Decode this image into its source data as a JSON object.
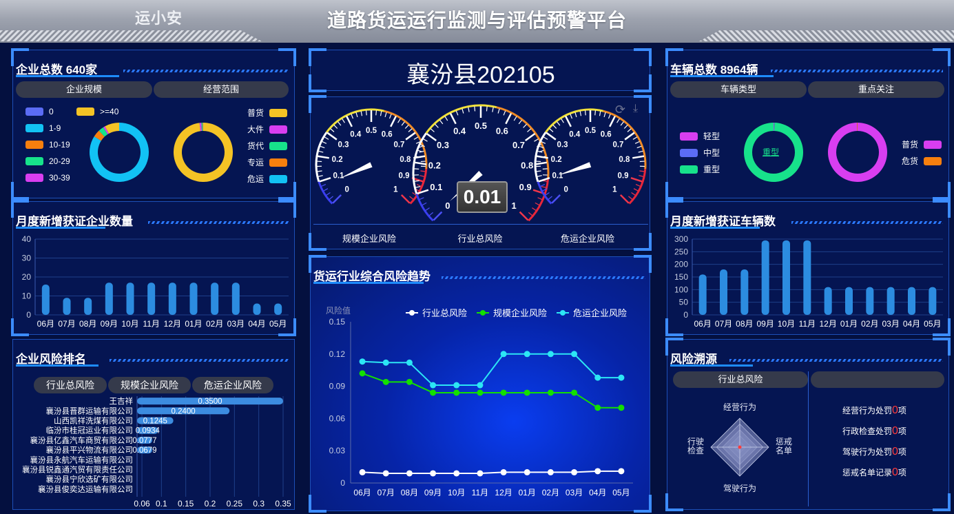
{
  "header": {
    "logo": "运小安",
    "title": "道路货运运行监测与评估预警平台"
  },
  "company": {
    "title": "企业总数 640家",
    "tabs": [
      "企业规模",
      "经营范围"
    ],
    "scale_legend": [
      {
        "label": "0",
        "color": "#5b6cf5"
      },
      {
        "label": ">=40",
        "color": "#f4c325"
      },
      {
        "label": "1-9",
        "color": "#12c2f4"
      },
      {
        "label": "10-19",
        "color": "#f77f0e"
      },
      {
        "label": "20-29",
        "color": "#17e28b"
      },
      {
        "label": "30-39",
        "color": "#d83ef0"
      }
    ],
    "scope_legend": [
      {
        "label": "普货",
        "color": "#f4c325"
      },
      {
        "label": "大件",
        "color": "#d83ef0"
      },
      {
        "label": "货代",
        "color": "#17e28b"
      },
      {
        "label": "专运",
        "color": "#f77f0e"
      },
      {
        "label": "危运",
        "color": "#12c2f4"
      }
    ]
  },
  "monthly_companies": {
    "title": "月度新增获证企业数量"
  },
  "risk_rank": {
    "title": "企业风险排名",
    "buttons": [
      "行业总风险",
      "规模企业风险",
      "危运企业风险"
    ]
  },
  "center": {
    "county_title": "襄汾县202105",
    "gauge_value": "0.01",
    "gauge_labels": [
      "规模企业风险",
      "行业总风险",
      "危运企业风险"
    ],
    "gauge_ticks": [
      "0",
      "0.1",
      "0.2",
      "0.3",
      "0.4",
      "0.5",
      "0.6",
      "0.7",
      "0.8",
      "0.9",
      "1"
    ],
    "trend_title": "货运行业综合风险趋势",
    "trend_yname": "风险值"
  },
  "vehicle": {
    "title": "车辆总数 8964辆",
    "tabs": [
      "车辆类型",
      "重点关注"
    ],
    "type_legend": [
      {
        "label": "轻型",
        "color": "#d83ef0"
      },
      {
        "label": "中型",
        "color": "#5b6cf5"
      },
      {
        "label": "重型",
        "color": "#17e28b"
      }
    ],
    "donut_center_label": "重型",
    "focus_legend": [
      {
        "label": "普货",
        "color": "#d83ef0"
      },
      {
        "label": "危货",
        "color": "#f77f0e"
      }
    ]
  },
  "monthly_vehicles": {
    "title": "月度新增获证车辆数"
  },
  "risk_source": {
    "title": "风险溯源",
    "tab": "行业总风险",
    "radar_labels": {
      "top": "经营行为",
      "right": "惩戒\n名单",
      "bottom": "驾驶行为",
      "left": "行驶\n检查"
    },
    "items": [
      {
        "label": "经营行为处罚",
        "count": "0",
        "unit": "项"
      },
      {
        "label": "行政检查处罚",
        "count": "0",
        "unit": "项"
      },
      {
        "label": "驾驶行为处罚",
        "count": "0",
        "unit": "项"
      },
      {
        "label": "惩戒名单记录",
        "count": "0",
        "unit": "项"
      }
    ]
  },
  "colors": {
    "bar": "#2c8ce0",
    "accent": "#1e8cff",
    "white_line": "#ffffff",
    "green_line": "#13e000",
    "cyan_line": "#2ce6f5"
  },
  "chart_data": [
    {
      "id": "company_scale_donut",
      "type": "pie",
      "categories": [
        "0",
        "1-9",
        "10-19",
        "20-29",
        "30-39",
        ">=40"
      ],
      "values": [
        0,
        84,
        4,
        3,
        1,
        8
      ]
    },
    {
      "id": "company_scope_donut",
      "type": "pie",
      "categories": [
        "普货",
        "大件",
        "货代",
        "专运",
        "危运"
      ],
      "values": [
        98,
        1,
        0.5,
        0.3,
        0.2
      ]
    },
    {
      "id": "monthly_companies",
      "type": "bar",
      "categories": [
        "06月",
        "07月",
        "08月",
        "09月",
        "10月",
        "11月",
        "12月",
        "01月",
        "02月",
        "03月",
        "04月",
        "05月"
      ],
      "values": [
        16,
        9,
        9,
        17,
        17,
        17,
        17,
        17,
        17,
        17,
        6,
        6
      ],
      "ylim": [
        0,
        40
      ],
      "yticks": [
        0,
        10,
        20,
        30,
        40
      ]
    },
    {
      "id": "risk_rank",
      "type": "bar",
      "orientation": "horizontal",
      "categories": [
        "王吉祥",
        "襄汾县晋群运输有限公司",
        "山西凯祥洗煤有限公司",
        "临汾市桂冠运业有限公司",
        "襄汾县亿鑫汽车商贸有限公司",
        "襄汾县平兴物流有限公司",
        "襄汾县永航汽车运输有限公司",
        "襄汾县锐鑫通汽贸有限责任公司",
        "襄汾县宁欣选矿有限公司",
        "襄汾县俊奕达运输有限公司"
      ],
      "values": [
        0.35,
        0.24,
        0.1245,
        0.0934,
        0.0777,
        0.0679,
        null,
        null,
        null,
        null
      ],
      "value_labels": [
        "0.3500",
        "0.2400",
        "0.1245",
        "0.0934",
        "0.0777",
        "0.0679"
      ],
      "xlim": [
        0.05,
        0.35
      ],
      "xticks": [
        "0.06",
        "0.1",
        "0.15",
        "0.2",
        "0.25",
        "0.3",
        "0.35"
      ]
    },
    {
      "id": "risk_gauges",
      "type": "gauge",
      "series": [
        {
          "name": "规模企业风险",
          "value": 0.08
        },
        {
          "name": "行业总风险",
          "value": 0.01
        },
        {
          "name": "危运企业风险",
          "value": 0.1
        }
      ],
      "range": [
        0,
        1
      ]
    },
    {
      "id": "risk_trend",
      "type": "line",
      "title": "货运行业综合风险趋势",
      "ylabel": "风险值",
      "categories": [
        "06月",
        "07月",
        "08月",
        "09月",
        "10月",
        "11月",
        "12月",
        "01月",
        "02月",
        "03月",
        "04月",
        "05月"
      ],
      "series": [
        {
          "name": "行业总风险",
          "color": "#ffffff",
          "values": [
            0.01,
            0.009,
            0.009,
            0.009,
            0.009,
            0.009,
            0.01,
            0.01,
            0.01,
            0.01,
            0.011,
            0.011
          ]
        },
        {
          "name": "规模企业风险",
          "color": "#13e000",
          "values": [
            0.102,
            0.094,
            0.094,
            0.084,
            0.084,
            0.084,
            0.084,
            0.084,
            0.084,
            0.084,
            0.07,
            0.07
          ]
        },
        {
          "name": "危运企业风险",
          "color": "#2ce6f5",
          "values": [
            0.113,
            0.112,
            0.112,
            0.091,
            0.091,
            0.091,
            0.12,
            0.12,
            0.12,
            0.12,
            0.098,
            0.098
          ]
        }
      ],
      "ylim": [
        0,
        0.15
      ],
      "yticks": [
        "0",
        "0.03",
        "0.06",
        "0.09",
        "0.12",
        "0.15"
      ],
      "legend": "top"
    },
    {
      "id": "vehicle_type_donut",
      "type": "pie",
      "categories": [
        "轻型",
        "中型",
        "重型"
      ],
      "values": [
        0.3,
        0.2,
        99.5
      ]
    },
    {
      "id": "vehicle_focus_donut",
      "type": "pie",
      "categories": [
        "普货",
        "危货"
      ],
      "values": [
        99.7,
        0.3
      ]
    },
    {
      "id": "monthly_vehicles",
      "type": "bar",
      "categories": [
        "06月",
        "07月",
        "08月",
        "09月",
        "10月",
        "11月",
        "12月",
        "01月",
        "02月",
        "03月",
        "04月",
        "05月"
      ],
      "values": [
        160,
        180,
        180,
        295,
        295,
        295,
        110,
        110,
        110,
        110,
        110,
        110
      ],
      "ylim": [
        0,
        300
      ],
      "yticks": [
        0,
        50,
        100,
        150,
        200,
        250,
        300
      ]
    }
  ]
}
